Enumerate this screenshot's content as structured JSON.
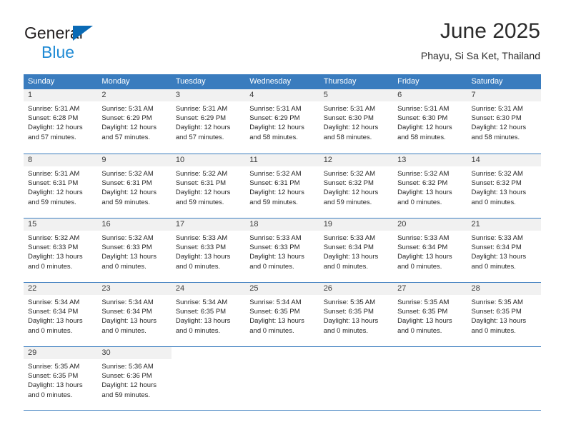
{
  "brand": {
    "line1": "General",
    "line2": "Blue",
    "triangle_color": "#0a6ab5",
    "blue_color": "#1f8ad4"
  },
  "header": {
    "title": "June 2025",
    "subtitle": "Phayu, Si Sa Ket, Thailand"
  },
  "theme": {
    "header_blue": "#3a7cbe",
    "daynum_band": "#f1f1f1",
    "text": "#262626"
  },
  "calendar": {
    "weekday_headers": [
      "Sunday",
      "Monday",
      "Tuesday",
      "Wednesday",
      "Thursday",
      "Friday",
      "Saturday"
    ],
    "weeks": [
      [
        {
          "day": "1",
          "sunrise": "Sunrise: 5:31 AM",
          "sunset": "Sunset: 6:28 PM",
          "daylight1": "Daylight: 12 hours",
          "daylight2": "and 57 minutes."
        },
        {
          "day": "2",
          "sunrise": "Sunrise: 5:31 AM",
          "sunset": "Sunset: 6:29 PM",
          "daylight1": "Daylight: 12 hours",
          "daylight2": "and 57 minutes."
        },
        {
          "day": "3",
          "sunrise": "Sunrise: 5:31 AM",
          "sunset": "Sunset: 6:29 PM",
          "daylight1": "Daylight: 12 hours",
          "daylight2": "and 57 minutes."
        },
        {
          "day": "4",
          "sunrise": "Sunrise: 5:31 AM",
          "sunset": "Sunset: 6:29 PM",
          "daylight1": "Daylight: 12 hours",
          "daylight2": "and 58 minutes."
        },
        {
          "day": "5",
          "sunrise": "Sunrise: 5:31 AM",
          "sunset": "Sunset: 6:30 PM",
          "daylight1": "Daylight: 12 hours",
          "daylight2": "and 58 minutes."
        },
        {
          "day": "6",
          "sunrise": "Sunrise: 5:31 AM",
          "sunset": "Sunset: 6:30 PM",
          "daylight1": "Daylight: 12 hours",
          "daylight2": "and 58 minutes."
        },
        {
          "day": "7",
          "sunrise": "Sunrise: 5:31 AM",
          "sunset": "Sunset: 6:30 PM",
          "daylight1": "Daylight: 12 hours",
          "daylight2": "and 58 minutes."
        }
      ],
      [
        {
          "day": "8",
          "sunrise": "Sunrise: 5:31 AM",
          "sunset": "Sunset: 6:31 PM",
          "daylight1": "Daylight: 12 hours",
          "daylight2": "and 59 minutes."
        },
        {
          "day": "9",
          "sunrise": "Sunrise: 5:32 AM",
          "sunset": "Sunset: 6:31 PM",
          "daylight1": "Daylight: 12 hours",
          "daylight2": "and 59 minutes."
        },
        {
          "day": "10",
          "sunrise": "Sunrise: 5:32 AM",
          "sunset": "Sunset: 6:31 PM",
          "daylight1": "Daylight: 12 hours",
          "daylight2": "and 59 minutes."
        },
        {
          "day": "11",
          "sunrise": "Sunrise: 5:32 AM",
          "sunset": "Sunset: 6:31 PM",
          "daylight1": "Daylight: 12 hours",
          "daylight2": "and 59 minutes."
        },
        {
          "day": "12",
          "sunrise": "Sunrise: 5:32 AM",
          "sunset": "Sunset: 6:32 PM",
          "daylight1": "Daylight: 12 hours",
          "daylight2": "and 59 minutes."
        },
        {
          "day": "13",
          "sunrise": "Sunrise: 5:32 AM",
          "sunset": "Sunset: 6:32 PM",
          "daylight1": "Daylight: 13 hours",
          "daylight2": "and 0 minutes."
        },
        {
          "day": "14",
          "sunrise": "Sunrise: 5:32 AM",
          "sunset": "Sunset: 6:32 PM",
          "daylight1": "Daylight: 13 hours",
          "daylight2": "and 0 minutes."
        }
      ],
      [
        {
          "day": "15",
          "sunrise": "Sunrise: 5:32 AM",
          "sunset": "Sunset: 6:33 PM",
          "daylight1": "Daylight: 13 hours",
          "daylight2": "and 0 minutes."
        },
        {
          "day": "16",
          "sunrise": "Sunrise: 5:32 AM",
          "sunset": "Sunset: 6:33 PM",
          "daylight1": "Daylight: 13 hours",
          "daylight2": "and 0 minutes."
        },
        {
          "day": "17",
          "sunrise": "Sunrise: 5:33 AM",
          "sunset": "Sunset: 6:33 PM",
          "daylight1": "Daylight: 13 hours",
          "daylight2": "and 0 minutes."
        },
        {
          "day": "18",
          "sunrise": "Sunrise: 5:33 AM",
          "sunset": "Sunset: 6:33 PM",
          "daylight1": "Daylight: 13 hours",
          "daylight2": "and 0 minutes."
        },
        {
          "day": "19",
          "sunrise": "Sunrise: 5:33 AM",
          "sunset": "Sunset: 6:34 PM",
          "daylight1": "Daylight: 13 hours",
          "daylight2": "and 0 minutes."
        },
        {
          "day": "20",
          "sunrise": "Sunrise: 5:33 AM",
          "sunset": "Sunset: 6:34 PM",
          "daylight1": "Daylight: 13 hours",
          "daylight2": "and 0 minutes."
        },
        {
          "day": "21",
          "sunrise": "Sunrise: 5:33 AM",
          "sunset": "Sunset: 6:34 PM",
          "daylight1": "Daylight: 13 hours",
          "daylight2": "and 0 minutes."
        }
      ],
      [
        {
          "day": "22",
          "sunrise": "Sunrise: 5:34 AM",
          "sunset": "Sunset: 6:34 PM",
          "daylight1": "Daylight: 13 hours",
          "daylight2": "and 0 minutes."
        },
        {
          "day": "23",
          "sunrise": "Sunrise: 5:34 AM",
          "sunset": "Sunset: 6:34 PM",
          "daylight1": "Daylight: 13 hours",
          "daylight2": "and 0 minutes."
        },
        {
          "day": "24",
          "sunrise": "Sunrise: 5:34 AM",
          "sunset": "Sunset: 6:35 PM",
          "daylight1": "Daylight: 13 hours",
          "daylight2": "and 0 minutes."
        },
        {
          "day": "25",
          "sunrise": "Sunrise: 5:34 AM",
          "sunset": "Sunset: 6:35 PM",
          "daylight1": "Daylight: 13 hours",
          "daylight2": "and 0 minutes."
        },
        {
          "day": "26",
          "sunrise": "Sunrise: 5:35 AM",
          "sunset": "Sunset: 6:35 PM",
          "daylight1": "Daylight: 13 hours",
          "daylight2": "and 0 minutes."
        },
        {
          "day": "27",
          "sunrise": "Sunrise: 5:35 AM",
          "sunset": "Sunset: 6:35 PM",
          "daylight1": "Daylight: 13 hours",
          "daylight2": "and 0 minutes."
        },
        {
          "day": "28",
          "sunrise": "Sunrise: 5:35 AM",
          "sunset": "Sunset: 6:35 PM",
          "daylight1": "Daylight: 13 hours",
          "daylight2": "and 0 minutes."
        }
      ],
      [
        {
          "day": "29",
          "sunrise": "Sunrise: 5:35 AM",
          "sunset": "Sunset: 6:35 PM",
          "daylight1": "Daylight: 13 hours",
          "daylight2": "and 0 minutes."
        },
        {
          "day": "30",
          "sunrise": "Sunrise: 5:36 AM",
          "sunset": "Sunset: 6:36 PM",
          "daylight1": "Daylight: 12 hours",
          "daylight2": "and 59 minutes."
        },
        {
          "day": "",
          "sunrise": "",
          "sunset": "",
          "daylight1": "",
          "daylight2": ""
        },
        {
          "day": "",
          "sunrise": "",
          "sunset": "",
          "daylight1": "",
          "daylight2": ""
        },
        {
          "day": "",
          "sunrise": "",
          "sunset": "",
          "daylight1": "",
          "daylight2": ""
        },
        {
          "day": "",
          "sunrise": "",
          "sunset": "",
          "daylight1": "",
          "daylight2": ""
        },
        {
          "day": "",
          "sunrise": "",
          "sunset": "",
          "daylight1": "",
          "daylight2": ""
        }
      ]
    ]
  }
}
